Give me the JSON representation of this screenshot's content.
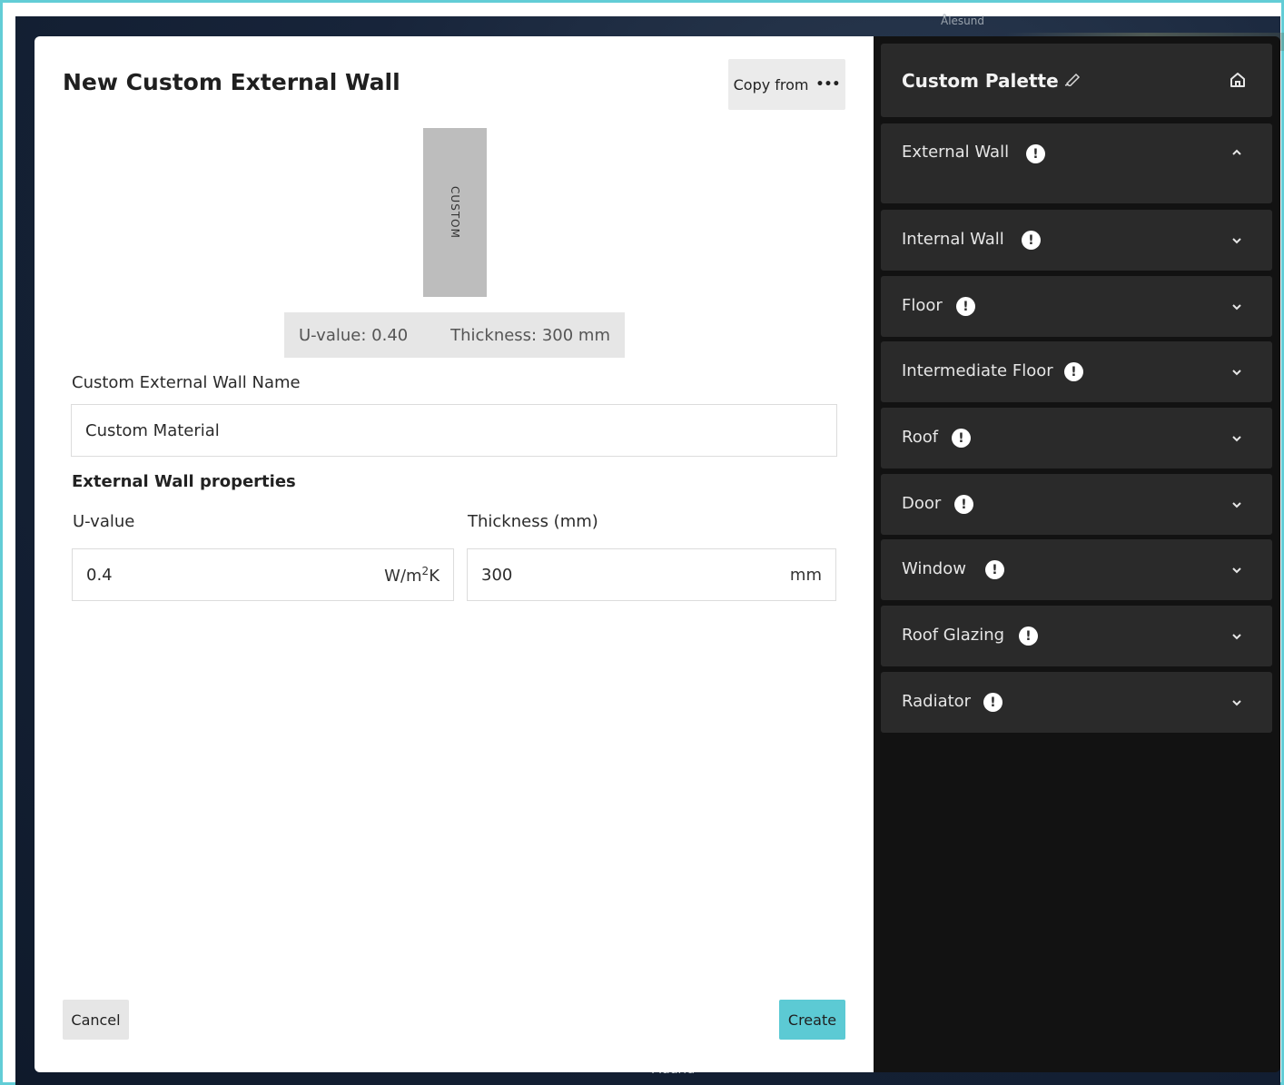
{
  "map": {
    "label_top": "Ålesund",
    "label_bottom": "Madrid"
  },
  "dialog": {
    "title": "New Custom External Wall",
    "copy_from_label": "Copy from",
    "copy_from_icon": "ellipsis-icon",
    "preview": {
      "wall_label": "CUSTOM",
      "u_value_summary": "U-value: 0.40",
      "thickness_summary": "Thickness: 300 mm"
    },
    "name_label": "Custom External Wall Name",
    "name_value": "Custom Material",
    "properties_heading": "External Wall properties",
    "u_value": {
      "label": "U-value",
      "value": "0.4",
      "unit_prefix": "W/m",
      "unit_sup": "2",
      "unit_suffix": "K"
    },
    "thickness": {
      "label": "Thickness (mm)",
      "value": "300",
      "unit": "mm"
    },
    "cancel_label": "Cancel",
    "create_label": "Create",
    "create_color": "#5ccad4"
  },
  "palette": {
    "title": "Custom Palette",
    "edit_icon": "pencil-icon",
    "home_icon": "home-icon",
    "items": [
      {
        "label": "External Wall",
        "expanded": true
      },
      {
        "label": "Internal Wall",
        "expanded": false
      },
      {
        "label": "Floor",
        "expanded": false
      },
      {
        "label": "Intermediate Floor",
        "expanded": false
      },
      {
        "label": "Roof",
        "expanded": false
      },
      {
        "label": "Door",
        "expanded": false
      },
      {
        "label": "Window",
        "expanded": false
      },
      {
        "label": "Roof Glazing",
        "expanded": false
      },
      {
        "label": "Radiator",
        "expanded": false
      }
    ],
    "warning_icon": "exclamation-circle-icon"
  },
  "colors": {
    "frame_border": "#62cdd6",
    "panel_bg": "#121212",
    "panel_item_bg": "#2a2a2a"
  }
}
